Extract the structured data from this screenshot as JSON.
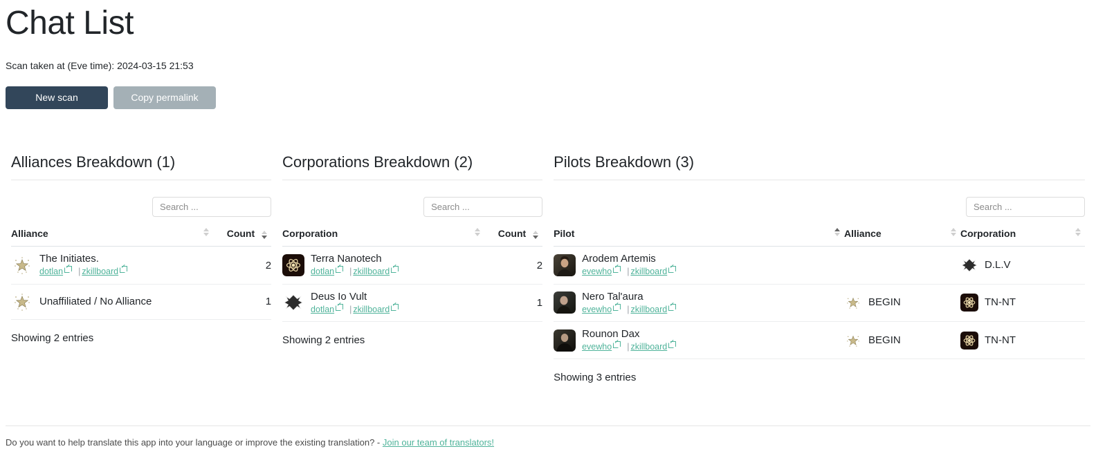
{
  "header": {
    "title": "Chat List",
    "scan_time_label": "Scan taken at (Eve time): 2024-03-15 21:53",
    "new_scan_label": "New scan",
    "copy_permalink_label": "Copy permalink",
    "primary_color": "#32465a",
    "secondary_color": "#a4b0b6"
  },
  "search": {
    "placeholder": "Search ..."
  },
  "link_color": "#4fb39a",
  "link_labels": {
    "dotlan": "dotlan",
    "zkillboard": "zkillboard",
    "evewho": "evewho",
    "separator": "|"
  },
  "alliances": {
    "title": "Alliances Breakdown (1)",
    "columns": [
      {
        "label": "Alliance",
        "sort": "none"
      },
      {
        "label": "Count",
        "sort": "desc"
      }
    ],
    "rows": [
      {
        "icon": "alliance-star-icon",
        "name": "The Initiates.",
        "has_links": true,
        "count": "2"
      },
      {
        "icon": "alliance-star-icon",
        "name": "Unaffiliated / No Alliance",
        "has_links": false,
        "count": "1"
      }
    ],
    "footer": "Showing 2 entries"
  },
  "corporations": {
    "title": "Corporations Breakdown (2)",
    "columns": [
      {
        "label": "Corporation",
        "sort": "none"
      },
      {
        "label": "Count",
        "sort": "desc"
      }
    ],
    "rows": [
      {
        "icon": "corp-atom-icon",
        "name": "Terra Nanotech",
        "has_links": true,
        "count": "2"
      },
      {
        "icon": "corp-cross-icon",
        "name": "Deus Io Vult",
        "has_links": true,
        "count": "1"
      }
    ],
    "footer": "Showing 2 entries"
  },
  "pilots": {
    "title": "Pilots Breakdown (3)",
    "columns": [
      {
        "label": "Pilot",
        "sort": "asc"
      },
      {
        "label": "Alliance",
        "sort": "none"
      },
      {
        "label": "Corporation",
        "sort": "none"
      }
    ],
    "rows": [
      {
        "portrait": "pilot-portrait-1",
        "name": "Arodem Artemis",
        "alliance": "",
        "alliance_icon": "",
        "corporation": "D.L.V",
        "corporation_icon": "corp-cross-icon"
      },
      {
        "portrait": "pilot-portrait-2",
        "name": "Nero Tal'aura",
        "alliance": "BEGIN",
        "alliance_icon": "alliance-star-icon",
        "corporation": "TN-NT",
        "corporation_icon": "corp-atom-icon"
      },
      {
        "portrait": "pilot-portrait-3",
        "name": "Rounon Dax",
        "alliance": "BEGIN",
        "alliance_icon": "alliance-star-icon",
        "corporation": "TN-NT",
        "corporation_icon": "corp-atom-icon"
      }
    ],
    "footer": "Showing 3 entries"
  },
  "bottom": {
    "translate_text": "Do you want to help translate this app into your language or improve the existing translation? -",
    "translate_link": "Join our team of translators!"
  }
}
